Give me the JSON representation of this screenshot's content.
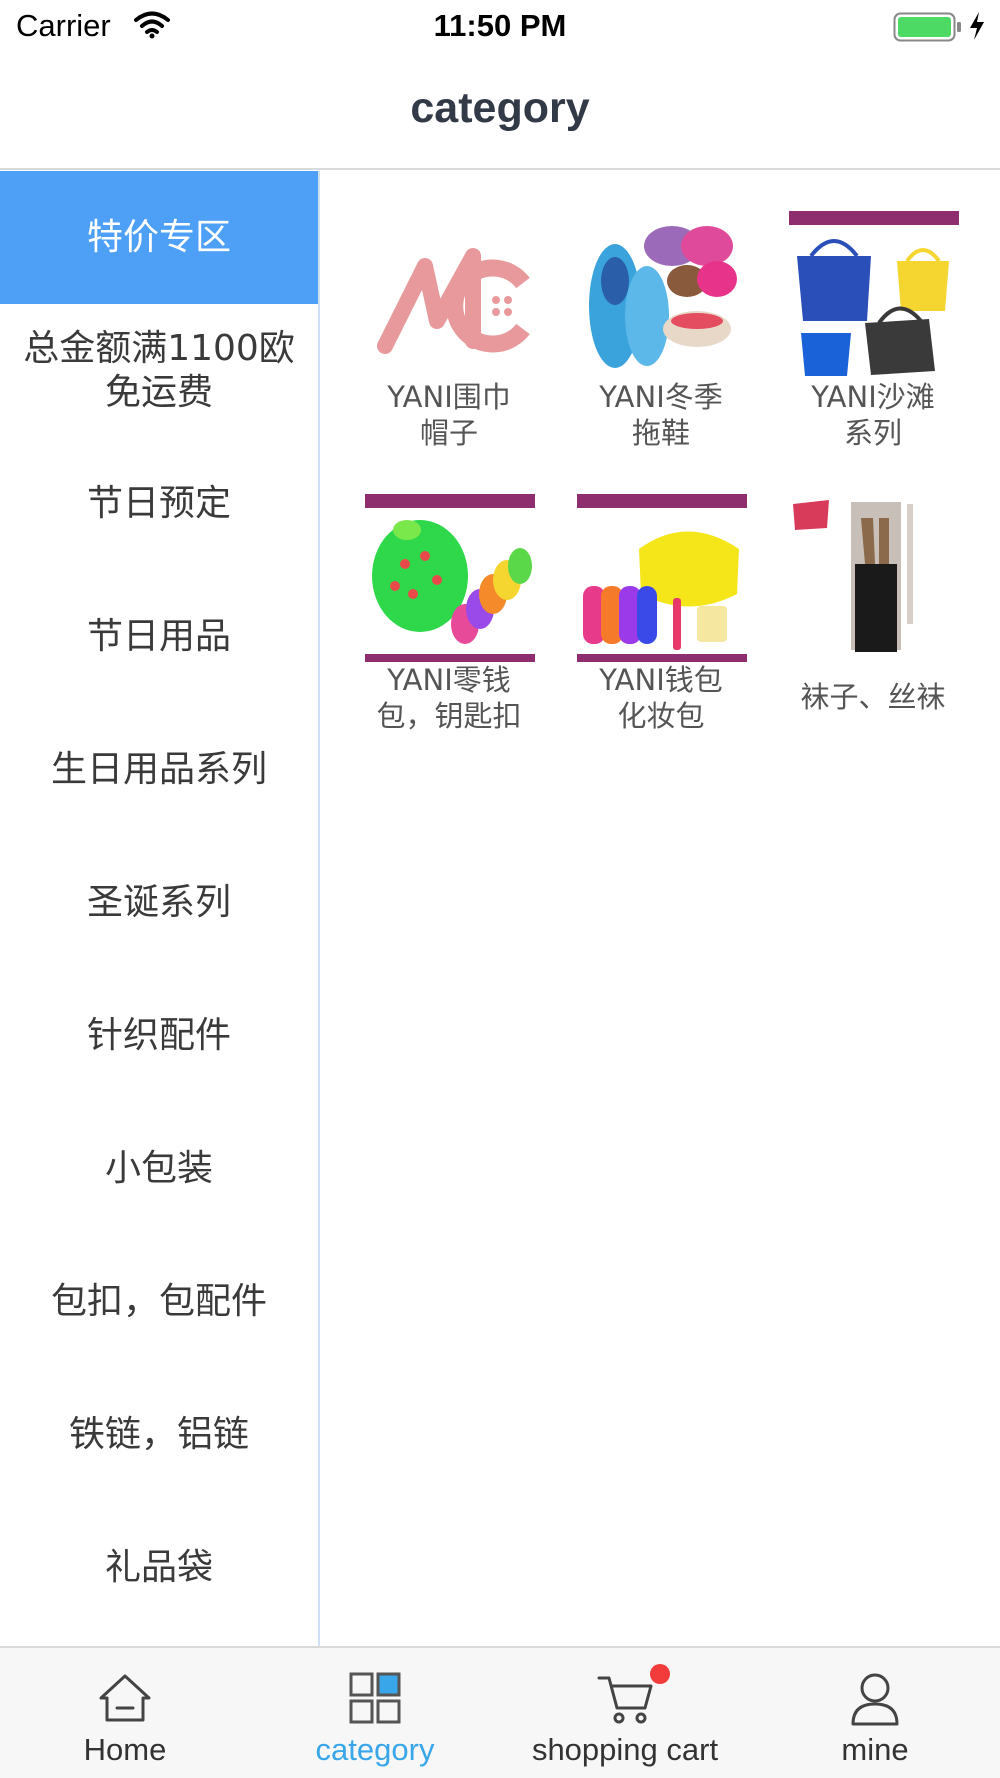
{
  "status_bar": {
    "carrier": "Carrier",
    "time": "11:50 PM"
  },
  "nav": {
    "title": "category"
  },
  "sidebar": {
    "items": [
      {
        "label": "特价专区",
        "active": true
      },
      {
        "label": "总金额满1100欧免运费",
        "active": false
      },
      {
        "label": "节日预定",
        "active": false
      },
      {
        "label": "节日用品",
        "active": false
      },
      {
        "label": "生日用品系列",
        "active": false
      },
      {
        "label": "圣诞系列",
        "active": false
      },
      {
        "label": "针织配件",
        "active": false
      },
      {
        "label": "小包装",
        "active": false
      },
      {
        "label": "包扣，包配件",
        "active": false
      },
      {
        "label": "铁链，铝链",
        "active": false
      },
      {
        "label": "礼品袋",
        "active": false
      }
    ]
  },
  "grid": {
    "items": [
      {
        "label_line1": "YANI围巾",
        "label_line2": "帽子",
        "icon": "mc-logo-image"
      },
      {
        "label_line1": "YANI冬季",
        "label_line2": "拖鞋",
        "icon": "slippers-image"
      },
      {
        "label_line1": "YANI沙滩",
        "label_line2": "系列",
        "icon": "beach-bags-image"
      },
      {
        "label_line1": "YANI零钱",
        "label_line2": "包，钥匙扣",
        "icon": "coin-purse-image"
      },
      {
        "label_line1": "YANI钱包",
        "label_line2": "化妆包",
        "icon": "cosmetic-bag-image"
      },
      {
        "label_line1": "袜子、丝袜",
        "label_line2": "",
        "icon": "stockings-image"
      }
    ]
  },
  "tabbar": {
    "tabs": [
      {
        "label": "Home",
        "icon": "home-icon",
        "active": false
      },
      {
        "label": "category",
        "icon": "category-icon",
        "active": true
      },
      {
        "label": "shopping cart",
        "icon": "cart-icon",
        "active": false
      },
      {
        "label": "mine",
        "icon": "user-icon",
        "active": false
      }
    ]
  },
  "colors": {
    "accent": "#4da0f5",
    "tab_active": "#38a6e8",
    "badge": "#f23b3b",
    "battery": "#4cd964"
  }
}
